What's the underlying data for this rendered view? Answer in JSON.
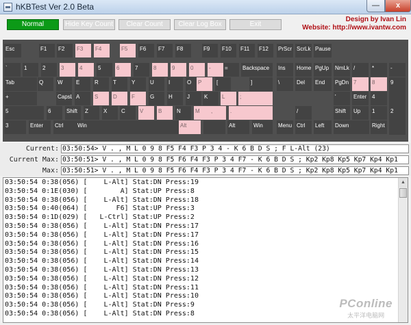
{
  "window": {
    "title": "hKBTest Ver 2.0 Beta",
    "minimize_label": "—",
    "close_label": "x"
  },
  "toolbar": {
    "normal": "Normal",
    "hide_key_count": "Hide Key Count",
    "clear_count": "Clear Count",
    "clear_log_box": "Clear Log Box",
    "exit": "Exit"
  },
  "credits": {
    "designer": "Design by Ivan Lin",
    "website": "Website: http://www.ivantw.com"
  },
  "keys": [
    {
      "label": "Esc",
      "state": "off"
    },
    {
      "label": "F1",
      "state": "off"
    },
    {
      "label": "F2",
      "state": "off"
    },
    {
      "label": "F3",
      "state": "on"
    },
    {
      "label": "F4",
      "state": "on"
    },
    {
      "label": "F5",
      "state": "on"
    },
    {
      "label": "F6",
      "state": "off"
    },
    {
      "label": "F7",
      "state": "off"
    },
    {
      "label": "F8",
      "state": "off"
    },
    {
      "label": "F9",
      "state": "off"
    },
    {
      "label": "F10",
      "state": "off"
    },
    {
      "label": "F11",
      "state": "off"
    },
    {
      "label": "F12",
      "state": "off"
    },
    {
      "label": "PrScr",
      "state": "off"
    },
    {
      "label": "ScrLk",
      "state": "off"
    },
    {
      "label": "Pause",
      "state": "off"
    },
    {
      "label": "`",
      "state": "off"
    },
    {
      "label": "1",
      "state": "off"
    },
    {
      "label": "2",
      "state": "off"
    },
    {
      "label": "3",
      "state": "on"
    },
    {
      "label": "4",
      "state": "on"
    },
    {
      "label": "5",
      "state": "off"
    },
    {
      "label": "6",
      "state": "on"
    },
    {
      "label": "7",
      "state": "off"
    },
    {
      "label": "8",
      "state": "on"
    },
    {
      "label": "9",
      "state": "on"
    },
    {
      "label": "0",
      "state": "on"
    },
    {
      "label": "-",
      "state": "on"
    },
    {
      "label": "=",
      "state": "off"
    },
    {
      "label": "Backspace",
      "state": "off"
    },
    {
      "label": "Ins",
      "state": "off"
    },
    {
      "label": "Home",
      "state": "off"
    },
    {
      "label": "PgUp",
      "state": "off"
    },
    {
      "label": "NmLk",
      "state": "off"
    },
    {
      "label": "/",
      "state": "off"
    },
    {
      "label": "*",
      "state": "off"
    },
    {
      "label": "-",
      "state": "off"
    },
    {
      "label": "Tab",
      "state": "off"
    },
    {
      "label": "Q",
      "state": "off"
    },
    {
      "label": "W",
      "state": "off"
    },
    {
      "label": "E",
      "state": "off"
    },
    {
      "label": "R",
      "state": "off"
    },
    {
      "label": "T",
      "state": "off"
    },
    {
      "label": "Y",
      "state": "off"
    },
    {
      "label": "U",
      "state": "off"
    },
    {
      "label": "I",
      "state": "off"
    },
    {
      "label": "O",
      "state": "off"
    },
    {
      "label": "P",
      "state": "on"
    },
    {
      "label": "[",
      "state": "off"
    },
    {
      "label": "]",
      "state": "off"
    },
    {
      "label": "\\",
      "state": "off"
    },
    {
      "label": "Del",
      "state": "off"
    },
    {
      "label": "End",
      "state": "off"
    },
    {
      "label": "PgDn",
      "state": "off"
    },
    {
      "label": "7",
      "state": "on"
    },
    {
      "label": "8",
      "state": "on"
    },
    {
      "label": "9",
      "state": "off"
    },
    {
      "label": "+",
      "state": "off"
    },
    {
      "label": "CapsLk",
      "state": "off"
    },
    {
      "label": "A",
      "state": "off"
    },
    {
      "label": "S",
      "state": "on"
    },
    {
      "label": "D",
      "state": "on"
    },
    {
      "label": "F",
      "state": "on"
    },
    {
      "label": "G",
      "state": "off"
    },
    {
      "label": "H",
      "state": "off"
    },
    {
      "label": "J",
      "state": "off"
    },
    {
      "label": "K",
      "state": "off"
    },
    {
      "label": "L",
      "state": "on"
    },
    {
      "label": ";",
      "state": "on"
    },
    {
      "label": "'",
      "state": "off"
    },
    {
      "label": "Enter",
      "state": "off"
    },
    {
      "label": "4",
      "state": "off"
    },
    {
      "label": "5",
      "state": "off"
    },
    {
      "label": "6",
      "state": "off"
    },
    {
      "label": "Shift",
      "state": "off"
    },
    {
      "label": "Z",
      "state": "off"
    },
    {
      "label": "X",
      "state": "off"
    },
    {
      "label": "C",
      "state": "off"
    },
    {
      "label": "V",
      "state": "on"
    },
    {
      "label": "B",
      "state": "on"
    },
    {
      "label": "N",
      "state": "off"
    },
    {
      "label": "M",
      "state": "on"
    },
    {
      "label": ",",
      "state": "on"
    },
    {
      "label": ".",
      "state": "on"
    },
    {
      "label": "/",
      "state": "off"
    },
    {
      "label": "Shift",
      "state": "off"
    },
    {
      "label": "Up",
      "state": "off"
    },
    {
      "label": "1",
      "state": "off"
    },
    {
      "label": "2",
      "state": "off"
    },
    {
      "label": "3",
      "state": "off"
    },
    {
      "label": "Enter",
      "state": "off"
    },
    {
      "label": "Ctrl",
      "state": "off"
    },
    {
      "label": "Win",
      "state": "off"
    },
    {
      "label": "Alt",
      "state": "on"
    },
    {
      "label": "",
      "state": "off"
    },
    {
      "label": "Alt",
      "state": "off"
    },
    {
      "label": "Win",
      "state": "off"
    },
    {
      "label": "Menu",
      "state": "off"
    },
    {
      "label": "Ctrl",
      "state": "off"
    },
    {
      "label": "Left",
      "state": "off"
    },
    {
      "label": "Down",
      "state": "off"
    },
    {
      "label": "Right",
      "state": "off"
    },
    {
      "label": "0",
      "state": "off"
    },
    {
      "label": ".",
      "state": "off"
    }
  ],
  "counters": {
    "current_label": "Current:",
    "current_value": "03:50:54> V . , M L 0 9 8 F5 F4 F3 P 3 4 - K 6 B D S ; F L-Alt (23)",
    "current_max_label": "Current Max:",
    "current_max_value": "03:50:51> V . , M L 0 9 8 F5 F6 F4 F3 P 3 4 F7 - K 6 B D S ; Kp2 Kp8 Kp5 Kp7 Kp4 Kp1",
    "max_label": "Max:",
    "max_value": "03:50:51> V . , M L 0 9 8 F5 F6 F4 F3 P 3 4 F7 - K 6 B D S ; Kp2 Kp8 Kp5 Kp7 Kp4 Kp1"
  },
  "log": [
    "03:50:54 0:38(056) [    L-Alt] Stat:DN Press:19",
    "03:50:54 0:1E(030) [        A] Stat:UP Press:8",
    "03:50:54 0:38(056) [    L-Alt] Stat:DN Press:18",
    "03:50:54 0:40(064) [       F6] Stat:UP Press:3",
    "03:50:54 0:1D(029) [   L-Ctrl] Stat:UP Press:2",
    "03:50:54 0:38(056) [    L-Alt] Stat:DN Press:17",
    "03:50:54 0:38(056) [    L-Alt] Stat:DN Press:17",
    "03:50:54 0:38(056) [    L-Alt] Stat:DN Press:16",
    "03:50:54 0:38(056) [    L-Alt] Stat:DN Press:15",
    "03:50:54 0:38(056) [    L-Alt] Stat:DN Press:14",
    "03:50:54 0:38(056) [    L-Alt] Stat:DN Press:13",
    "03:50:54 0:38(056) [    L-Alt] Stat:DN Press:12",
    "03:50:54 0:38(056) [    L-Alt] Stat:DN Press:11",
    "03:50:54 0:38(056) [    L-Alt] Stat:DN Press:10",
    "03:50:54 0:38(056) [    L-Alt] Stat:DN Press:9",
    "03:50:54 0:38(056) [    L-Alt] Stat:DN Press:8"
  ],
  "watermark": {
    "logo": "PConline",
    "sub": "太平洋电脑网"
  }
}
